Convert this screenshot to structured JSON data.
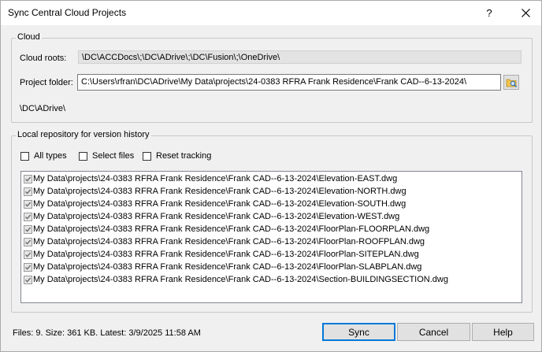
{
  "window": {
    "title": "Sync Central Cloud Projects",
    "help_glyph": "?",
    "close_icon": "close-icon"
  },
  "cloud": {
    "legend": "Cloud",
    "roots_label": "Cloud roots:",
    "roots_value": "\\DC\\ACCDocs\\;\\DC\\ADrive\\;\\DC\\Fusion\\;\\OneDrive\\",
    "folder_label": "Project folder:",
    "folder_value": "C:\\Users\\rfran\\DC\\ADrive\\My Data\\projects\\24-0383 RFRA Frank Residence\\Frank CAD--6-13-2024\\",
    "browse_icon": "folder-browse-icon",
    "drive_text": "\\DC\\ADrive\\"
  },
  "local": {
    "legend": "Local repository for version history",
    "options": [
      {
        "label": "All types",
        "checked": false
      },
      {
        "label": "Select files",
        "checked": false
      },
      {
        "label": "Reset tracking",
        "checked": false
      }
    ],
    "files": [
      "My Data\\projects\\24-0383 RFRA Frank Residence\\Frank CAD--6-13-2024\\Elevation-EAST.dwg",
      "My Data\\projects\\24-0383 RFRA Frank Residence\\Frank CAD--6-13-2024\\Elevation-NORTH.dwg",
      "My Data\\projects\\24-0383 RFRA Frank Residence\\Frank CAD--6-13-2024\\Elevation-SOUTH.dwg",
      "My Data\\projects\\24-0383 RFRA Frank Residence\\Frank CAD--6-13-2024\\Elevation-WEST.dwg",
      "My Data\\projects\\24-0383 RFRA Frank Residence\\Frank CAD--6-13-2024\\FloorPlan-FLOORPLAN.dwg",
      "My Data\\projects\\24-0383 RFRA Frank Residence\\Frank CAD--6-13-2024\\FloorPlan-ROOFPLAN.dwg",
      "My Data\\projects\\24-0383 RFRA Frank Residence\\Frank CAD--6-13-2024\\FloorPlan-SITEPLAN.dwg",
      "My Data\\projects\\24-0383 RFRA Frank Residence\\Frank CAD--6-13-2024\\FloorPlan-SLABPLAN.dwg",
      "My Data\\projects\\24-0383 RFRA Frank Residence\\Frank CAD--6-13-2024\\Section-BUILDINGSECTION.dwg"
    ]
  },
  "status": "Files: 9. Size: 361 KB. Latest: 3/9/2025 11:58 AM",
  "buttons": {
    "sync": "Sync",
    "cancel": "Cancel",
    "help": "Help"
  },
  "colors": {
    "dialog_bg": "#f0f0f0",
    "accent": "#0078d7"
  }
}
